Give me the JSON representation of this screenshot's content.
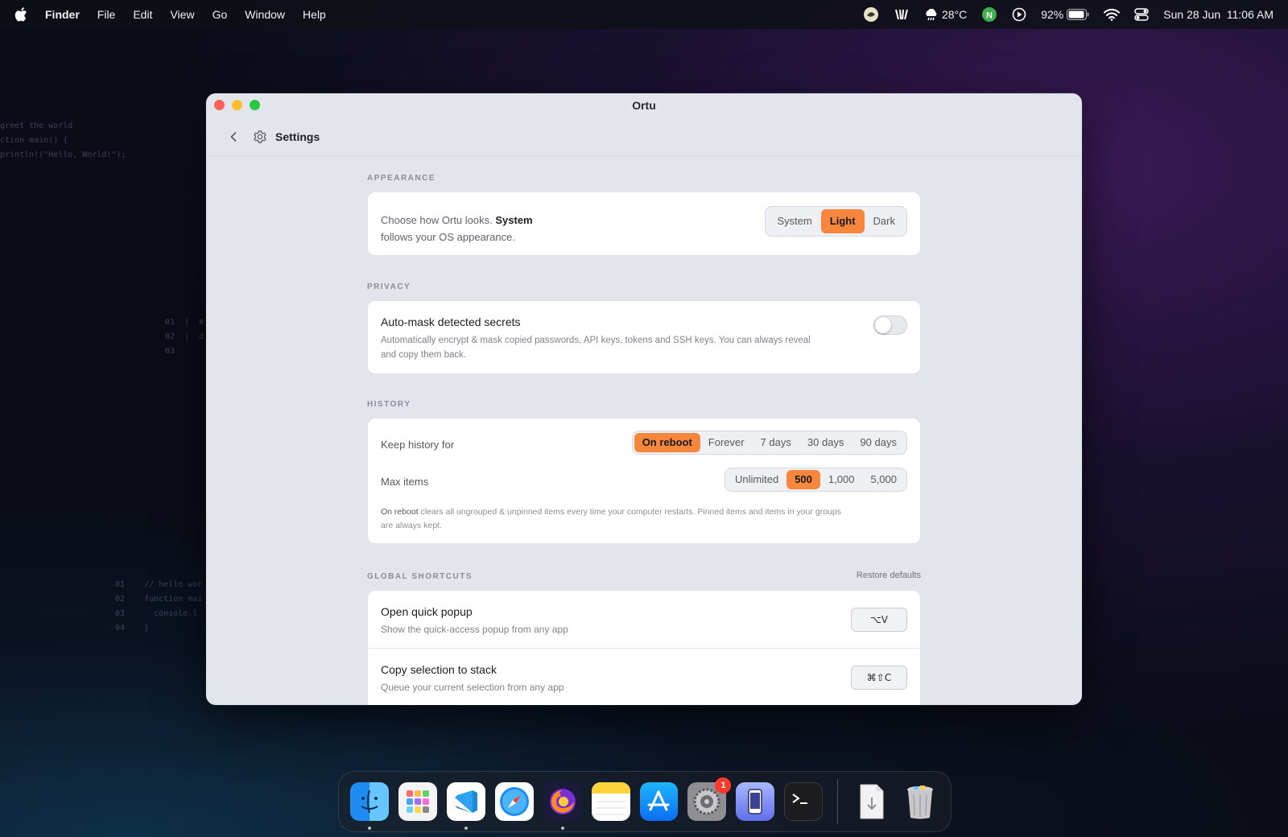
{
  "menubar": {
    "app_name": "Finder",
    "menus": [
      "File",
      "Edit",
      "View",
      "Go",
      "Window",
      "Help"
    ],
    "weather": "28°C",
    "battery": "92%",
    "datetime": "Sun 28 Jun  11:06 AM"
  },
  "window": {
    "title": "Ortu",
    "toolbar_title": "Settings"
  },
  "appearance": {
    "label": "APPEARANCE",
    "description_pre": "Choose how Ortu looks. ",
    "description_bold": "System",
    "description_post": "follows your OS appearance.",
    "options": [
      "System",
      "Light",
      "Dark"
    ],
    "selected": "Light"
  },
  "privacy": {
    "label": "PRIVACY",
    "title": "Auto-mask detected secrets",
    "description_line1": "Automatically encrypt & mask copied passwords, API keys, tokens and SSH keys. You can always reveal",
    "description_line2": "and copy them back.",
    "enabled": false
  },
  "history": {
    "label": "HISTORY",
    "keep_label": "Keep history for",
    "keep_options": [
      "On reboot",
      "Forever",
      "7 days",
      "30 days",
      "90 days"
    ],
    "keep_selected": "On reboot",
    "max_label": "Max items",
    "max_options": [
      "Unlimited",
      "500",
      "1,000",
      "5,000"
    ],
    "max_selected": "500",
    "note_bold": "On reboot",
    "note_line1": " clears all ungrouped & unpinned items every time your computer restarts. Pinned items and items in your groups",
    "note_line2": "are always kept."
  },
  "shortcuts": {
    "label": "GLOBAL SHORTCUTS",
    "restore_label": "Restore defaults",
    "items": [
      {
        "title": "Open quick popup",
        "description": "Show the quick-access popup from any app",
        "keys": "⌥V"
      },
      {
        "title": "Copy selection to stack",
        "description": "Queue your current selection from any app",
        "keys": "⌘⇧C"
      }
    ]
  },
  "dock": {
    "settings_badge": "1"
  },
  "colors": {
    "accent": "#f7873d",
    "window_bg": "#e3e5ec",
    "card_bg": "#ffffff"
  }
}
